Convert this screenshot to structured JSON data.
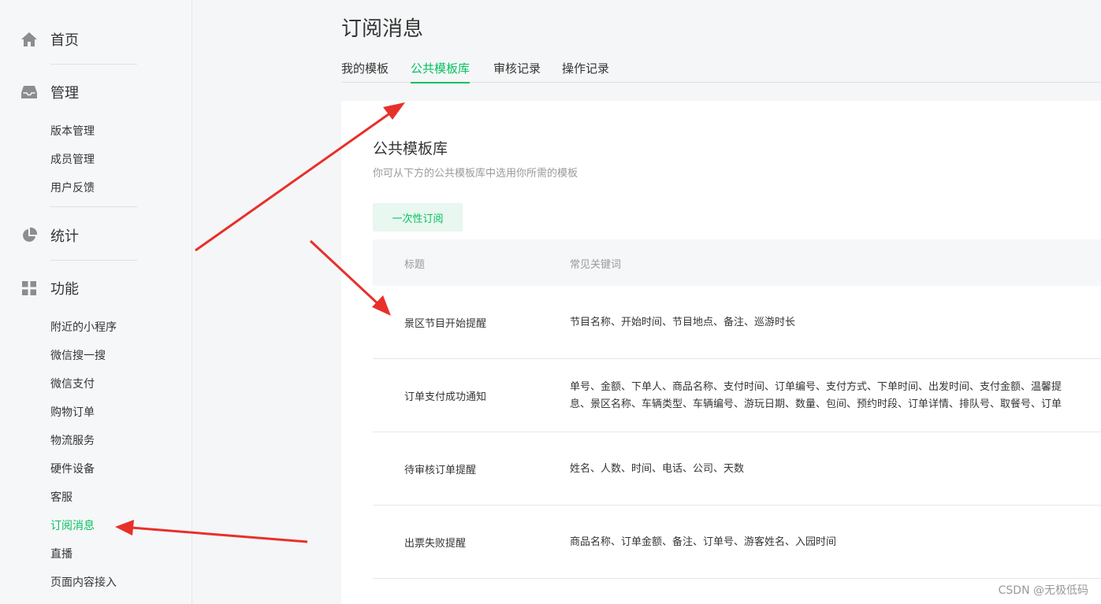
{
  "sidebar": {
    "home_label": "首页",
    "manage_label": "管理",
    "manage_items": [
      "版本管理",
      "成员管理",
      "用户反馈"
    ],
    "stats_label": "统计",
    "func_label": "功能",
    "func_items": [
      "附近的小程序",
      "微信搜一搜",
      "微信支付",
      "购物订单",
      "物流服务",
      "硬件设备",
      "客服",
      "订阅消息",
      "直播",
      "页面内容接入"
    ],
    "active_item": "订阅消息"
  },
  "page": {
    "title": "订阅消息",
    "tabs": [
      "我的模板",
      "公共模板库",
      "审核记录",
      "操作记录"
    ],
    "active_tab": "公共模板库"
  },
  "card": {
    "title": "公共模板库",
    "desc": "你可从下方的公共模板库中选用你所需的模板",
    "button": "一次性订阅"
  },
  "table": {
    "headers": [
      "标题",
      "常见关键词"
    ],
    "rows": [
      {
        "title": "景区节目开始提醒",
        "keywords": "节目名称、开始时间、节目地点、备注、巡游时长",
        "keywords2": ""
      },
      {
        "title": "订单支付成功通知",
        "keywords": "单号、金额、下单人、商品名称、支付时间、订单编号、支付方式、下单时间、出发时间、支付金额、温馨提",
        "keywords2": "息、景区名称、车辆类型、车辆编号、游玩日期、数量、包间、预约时段、订单详情、排队号、取餐号、订单"
      },
      {
        "title": "待审核订单提醒",
        "keywords": "姓名、人数、时间、电话、公司、天数",
        "keywords2": ""
      },
      {
        "title": "出票失败提醒",
        "keywords": "商品名称、订单金额、备注、订单号、游客姓名、入园时间",
        "keywords2": ""
      }
    ]
  },
  "watermark": "CSDN @无极低码",
  "colors": {
    "accent": "#07c160",
    "arrow": "#e8302a"
  }
}
